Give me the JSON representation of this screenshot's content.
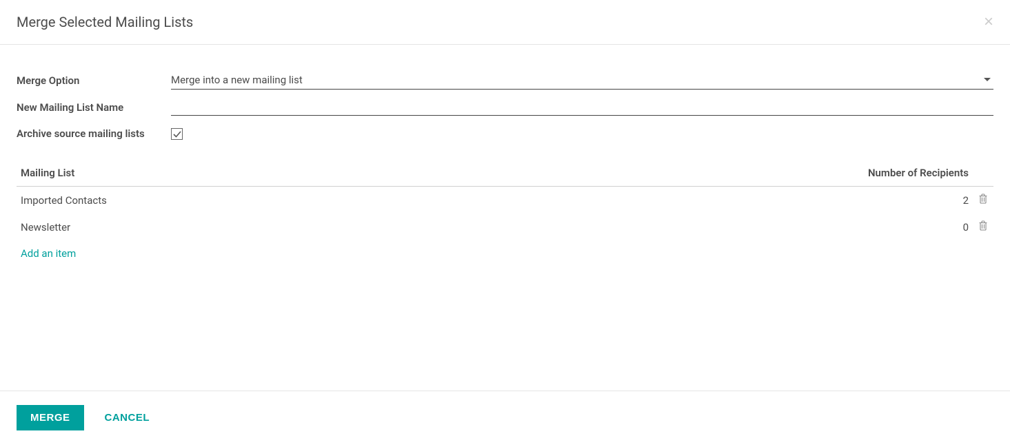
{
  "header": {
    "title": "Merge Selected Mailing Lists",
    "close_label": "×"
  },
  "form": {
    "merge_option": {
      "label": "Merge Option",
      "value": "Merge into a new mailing list"
    },
    "new_list_name": {
      "label": "New Mailing List Name",
      "value": ""
    },
    "archive_source": {
      "label": "Archive source mailing lists",
      "checked": true
    }
  },
  "table": {
    "columns": {
      "mailing_list": "Mailing List",
      "recipients": "Number of Recipients"
    },
    "rows": [
      {
        "name": "Imported Contacts",
        "recipients": "2"
      },
      {
        "name": "Newsletter",
        "recipients": "0"
      }
    ],
    "add_item": "Add an item"
  },
  "footer": {
    "merge": "MERGE",
    "cancel": "CANCEL"
  }
}
